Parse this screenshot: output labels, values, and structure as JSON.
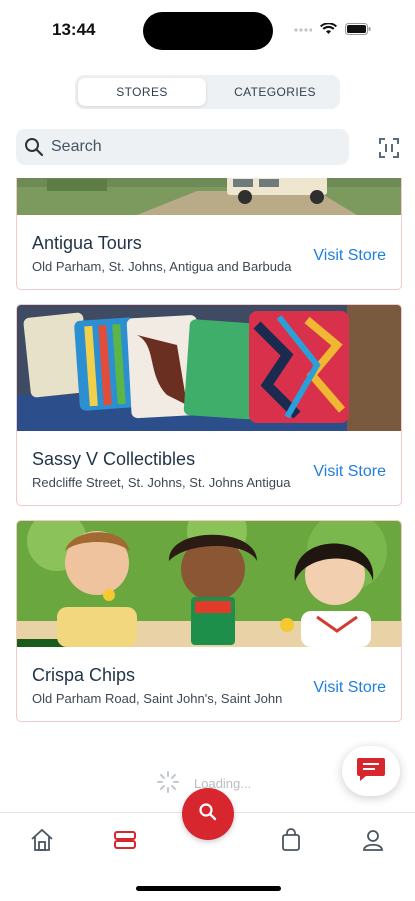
{
  "status_bar": {
    "time": "13:44"
  },
  "segmented": {
    "stores_label": "STORES",
    "categories_label": "CATEGORIES"
  },
  "search": {
    "placeholder": "Search"
  },
  "stores": [
    {
      "name": "Antigua Tours",
      "address": "Old Parham, St. Johns, Antigua and Barbuda",
      "action": "Visit Store"
    },
    {
      "name": "Sassy V Collectibles",
      "address": "Redcliffe Street, St. Johns, St. Johns Antigua",
      "action": "Visit Store"
    },
    {
      "name": "Crispa Chips",
      "address": "Old Parham Road, Saint John's, Saint John",
      "action": "Visit Store"
    }
  ],
  "loading_text": "Loading...",
  "tabbar": {
    "items": [
      "home-icon",
      "stores-icon",
      "search-icon",
      "bag-icon",
      "profile-icon"
    ]
  },
  "colors": {
    "accent": "#d8262f",
    "link": "#1f7fe0",
    "card_border": "#f3c9c9"
  }
}
